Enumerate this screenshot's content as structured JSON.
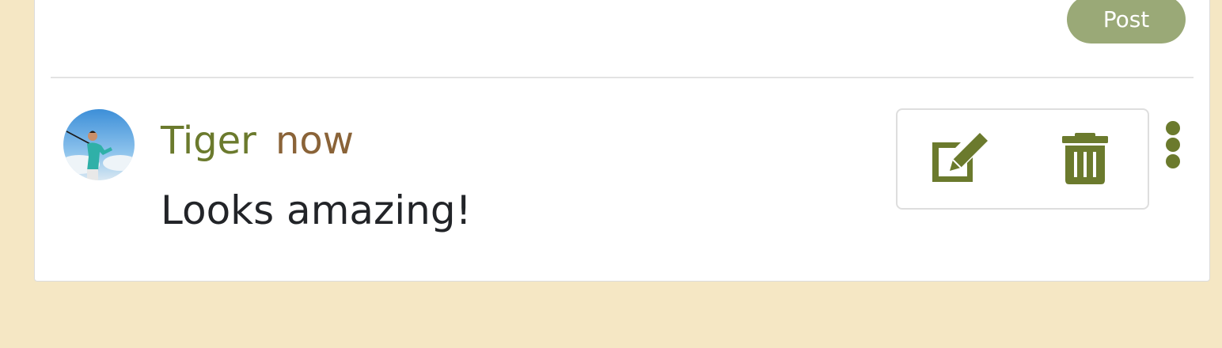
{
  "composer": {
    "post_label": "Post"
  },
  "comment": {
    "author": "Tiger",
    "time": "now",
    "text": "Looks amazing!",
    "avatar_alt": "Tiger avatar"
  },
  "actions": {
    "edit_icon": "edit-icon",
    "delete_icon": "trash-icon",
    "more_icon": "more-vertical-icon"
  },
  "colors": {
    "accent_green": "#6b7a2d",
    "post_button_bg": "#9aa977",
    "timestamp_brown": "#8a6338",
    "page_bg": "#f5e7c4"
  }
}
